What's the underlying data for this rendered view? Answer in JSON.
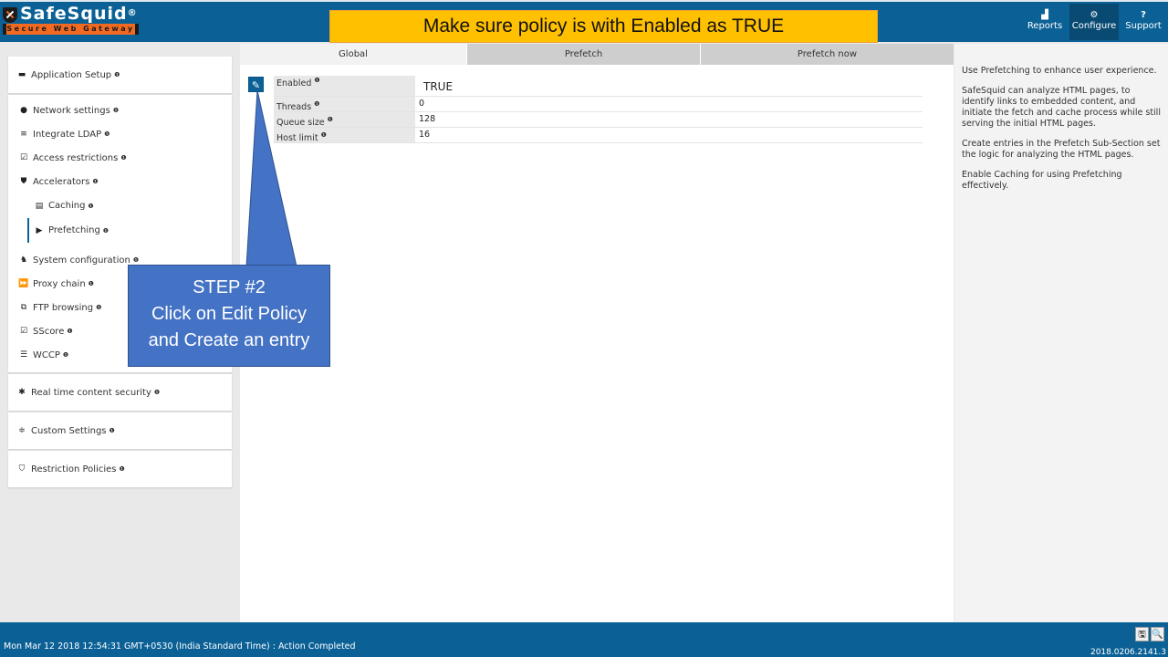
{
  "header": {
    "logo_title": "SafeSquid",
    "logo_reg": "®",
    "logo_tagline": "Secure Web Gateway",
    "banner": "Make sure policy is with Enabled as TRUE",
    "nav": [
      {
        "label": "Reports",
        "icon": "chart-icon",
        "glyph": "▟"
      },
      {
        "label": "Configure",
        "icon": "cogs-icon",
        "glyph": "⚙",
        "active": true
      },
      {
        "label": "Support",
        "icon": "question-icon",
        "glyph": "?"
      }
    ]
  },
  "sidebar": {
    "info_glyph": "❶",
    "groups": [
      {
        "label": "Application Setup",
        "icon": "briefcase-icon",
        "glyph": "▬"
      },
      {
        "label": "Real time content security",
        "icon": "bug-icon",
        "glyph": "✱"
      },
      {
        "label": "Custom Settings",
        "icon": "sliders-icon",
        "glyph": "≑"
      },
      {
        "label": "Restriction Policies",
        "icon": "shield-icon",
        "glyph": "⛉"
      }
    ],
    "items": [
      {
        "label": "Network settings",
        "icon": "globe-icon",
        "glyph": "●"
      },
      {
        "label": "Integrate LDAP",
        "icon": "list-icon",
        "glyph": "≡"
      },
      {
        "label": "Access restrictions",
        "icon": "checkbox-icon",
        "glyph": "☑"
      },
      {
        "label": "Accelerators",
        "icon": "accelerator-icon",
        "glyph": "⛊"
      },
      {
        "label": "Caching",
        "icon": "database-icon",
        "glyph": "▤"
      },
      {
        "label": "Prefetching",
        "icon": "step-forward-icon",
        "glyph": "▶"
      },
      {
        "label": "System configuration",
        "icon": "sitemap-icon",
        "glyph": "♞"
      },
      {
        "label": "Proxy chain",
        "icon": "fast-forward-icon",
        "glyph": "⏩"
      },
      {
        "label": "FTP browsing",
        "icon": "copy-icon",
        "glyph": "⧉"
      },
      {
        "label": "SScore",
        "icon": "checkbox-icon",
        "glyph": "☑"
      },
      {
        "label": "WCCP",
        "icon": "server-icon",
        "glyph": "☰"
      }
    ]
  },
  "main": {
    "tabs": [
      {
        "label": "Global",
        "active": true
      },
      {
        "label": "Prefetch"
      },
      {
        "label": "Prefetch now"
      }
    ],
    "edit_glyph": "✎",
    "properties": [
      {
        "key": "Enabled",
        "value": "TRUE"
      },
      {
        "key": "Threads",
        "value": "0"
      },
      {
        "key": "Queue size",
        "value": "128"
      },
      {
        "key": "Host limit",
        "value": "16"
      }
    ]
  },
  "callout": {
    "line1": "STEP #2",
    "line2": "Click on Edit Policy",
    "line3": "and Create an entry"
  },
  "help": {
    "paragraphs": [
      "Use Prefetching to enhance user experience.",
      "SafeSquid can analyze HTML pages, to identify links to embedded content, and initiate the fetch and cache process while still serving the initial HTML pages.",
      "Create entries in the Prefetch Sub-Section set the logic for analyzing the HTML pages.",
      "Enable Caching for using Prefetching effectively."
    ]
  },
  "footer": {
    "status": "Mon Mar 12 2018 12:54:31 GMT+0530 (India Standard Time) : Action Completed",
    "version": "2018.0206.2141.3",
    "save_glyph": "🖫",
    "search_glyph": "🔍"
  }
}
